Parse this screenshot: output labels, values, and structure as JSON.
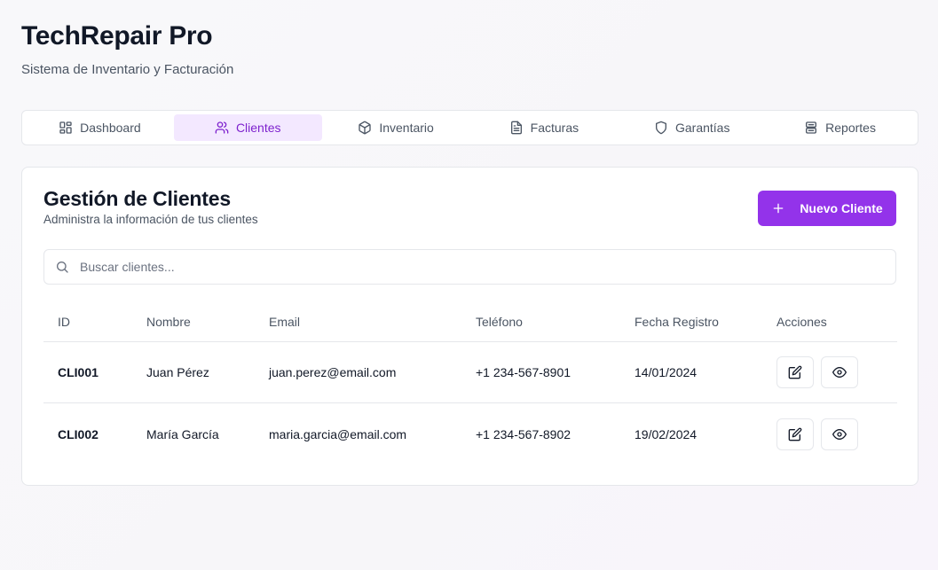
{
  "app": {
    "title": "TechRepair Pro",
    "subtitle": "Sistema de Inventario y Facturación"
  },
  "tabs": [
    {
      "label": "Dashboard",
      "icon": "dashboard-icon",
      "active": false
    },
    {
      "label": "Clientes",
      "icon": "users-icon",
      "active": true
    },
    {
      "label": "Inventario",
      "icon": "package-icon",
      "active": false
    },
    {
      "label": "Facturas",
      "icon": "file-text-icon",
      "active": false
    },
    {
      "label": "Garantías",
      "icon": "shield-icon",
      "active": false
    },
    {
      "label": "Reportes",
      "icon": "reports-icon",
      "active": false
    }
  ],
  "clients": {
    "title": "Gestión de Clientes",
    "description": "Administra la información de tus clientes",
    "new_button_label": "Nuevo Cliente",
    "search_placeholder": "Buscar clientes...",
    "columns": {
      "id": "ID",
      "name": "Nombre",
      "email": "Email",
      "phone": "Teléfono",
      "date": "Fecha Registro",
      "actions": "Acciones"
    },
    "rows": [
      {
        "id": "CLI001",
        "name": "Juan Pérez",
        "email": "juan.perez@email.com",
        "phone": "+1 234-567-8901",
        "date": "14/01/2024"
      },
      {
        "id": "CLI002",
        "name": "María García",
        "email": "maria.garcia@email.com",
        "phone": "+1 234-567-8902",
        "date": "19/02/2024"
      }
    ]
  },
  "colors": {
    "accent": "#9333ea",
    "active_tab_bg": "#f3e8ff",
    "active_tab_text": "#7e22ce"
  }
}
